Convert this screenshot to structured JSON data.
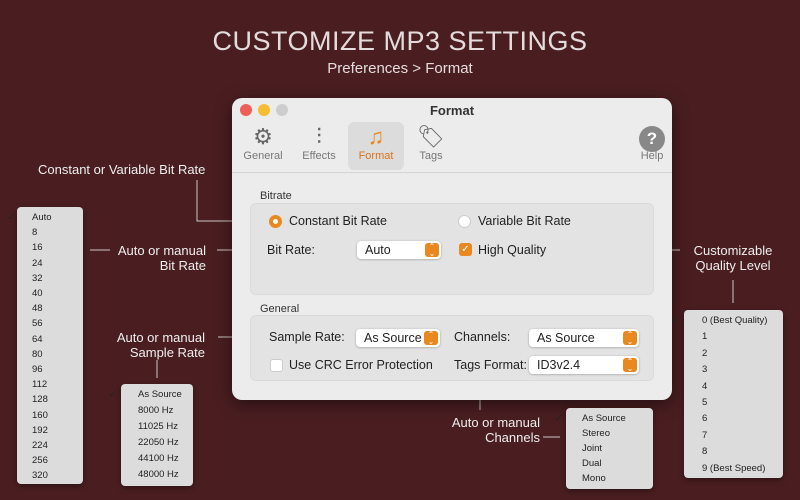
{
  "header": {
    "title": "CUSTOMIZE MP3 SETTINGS",
    "subtitle": "Preferences > Format"
  },
  "window": {
    "title": "Format",
    "toolbar": [
      {
        "label": "General",
        "icon": "gear-icon"
      },
      {
        "label": "Effects",
        "icon": "sliders-icon"
      },
      {
        "label": "Format",
        "icon": "music-note-icon",
        "selected": true
      },
      {
        "label": "Tags",
        "icon": "tag-icon"
      }
    ],
    "help_label": "Help",
    "bitrate": {
      "section": "Bitrate",
      "constant": "Constant Bit Rate",
      "variable": "Variable Bit Rate",
      "selected_mode": "constant",
      "bitrate_label": "Bit Rate:",
      "bitrate_value": "Auto",
      "high_quality_label": "High Quality",
      "high_quality_checked": true
    },
    "general": {
      "section": "General",
      "sample_rate_label": "Sample Rate:",
      "sample_rate_value": "As Source",
      "channels_label": "Channels:",
      "channels_value": "As Source",
      "crc_label": "Use CRC Error Protection",
      "crc_checked": false,
      "tags_format_label": "Tags Format:",
      "tags_format_value": "ID3v2.4"
    }
  },
  "annotations": {
    "mode": "Constant or Variable Bit Rate",
    "bitrate": [
      "Auto or manual",
      "Bit Rate"
    ],
    "sample_rate": [
      "Auto or manual",
      "Sample Rate"
    ],
    "quality": [
      "Customizable",
      "Quality Level"
    ],
    "channels": [
      "Auto or manual",
      "Channels"
    ]
  },
  "menus": {
    "bitrate": [
      "Auto",
      "8",
      "16",
      "24",
      "32",
      "40",
      "48",
      "56",
      "64",
      "80",
      "96",
      "112",
      "128",
      "160",
      "192",
      "224",
      "256",
      "320"
    ],
    "sample_rate": [
      "As Source",
      "8000 Hz",
      "11025 Hz",
      "22050 Hz",
      "44100 Hz",
      "48000 Hz"
    ],
    "channels": [
      "As Source",
      "Stereo",
      "Joint",
      "Dual",
      "Mono"
    ],
    "quality": [
      "0 (Best Quality)",
      "1",
      "2",
      "3",
      "4",
      "5",
      "6",
      "7",
      "8",
      "9 (Best Speed)"
    ]
  },
  "colors": {
    "accent": "#e8881f",
    "background": "#4a1e21"
  }
}
